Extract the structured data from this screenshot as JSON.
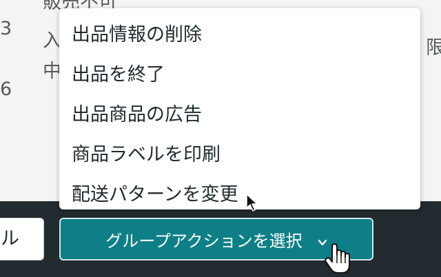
{
  "background_rows": [
    {
      "text": "3"
    },
    {
      "text": "6"
    },
    {
      "text": "販売不可"
    },
    {
      "text": "入"
    },
    {
      "text": "中"
    },
    {
      "text": "限"
    }
  ],
  "menu": {
    "items": [
      {
        "label": "出品情報の削除"
      },
      {
        "label": "出品を終了"
      },
      {
        "label": "出品商品の広告"
      },
      {
        "label": "商品ラベルを印刷"
      },
      {
        "label": "配送パターンを変更"
      }
    ]
  },
  "bottom_bar": {
    "left_button_label": "ル",
    "group_action_label": "グループアクションを選択",
    "group_action_icon": "chevron-down-icon"
  },
  "colors": {
    "accent_button": "#0e7f87",
    "bottom_bar": "#222b2f",
    "menu_text": "#1f2a2e"
  }
}
